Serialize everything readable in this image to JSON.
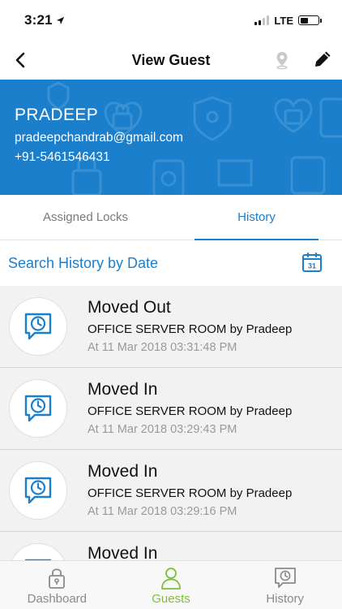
{
  "status_bar": {
    "time": "3:21",
    "network": "LTE",
    "signal_bars_on": 2,
    "battery_level": 0.45
  },
  "nav": {
    "title": "View Guest",
    "back_icon": "chevron-left-icon",
    "location_icon": "location-pin-icon",
    "edit_icon": "pencil-icon"
  },
  "guest": {
    "name": "PRADEEP",
    "email": "pradeepchandrab@gmail.com",
    "phone": "+91-5461546431"
  },
  "tabs": [
    {
      "label": "Assigned Locks",
      "active": false
    },
    {
      "label": "History",
      "active": true
    }
  ],
  "search": {
    "label": "Search History by Date",
    "calendar_day": "31"
  },
  "history": [
    {
      "title": "Moved Out",
      "lock": "OFFICE SERVER ROOM by Pradeep",
      "time": "At 11 Mar 2018 03:31:48 PM"
    },
    {
      "title": "Moved In",
      "lock": "OFFICE SERVER ROOM by Pradeep",
      "time": "At 11 Mar 2018 03:29:43 PM"
    },
    {
      "title": "Moved In",
      "lock": "OFFICE SERVER ROOM by Pradeep",
      "time": "At 11 Mar 2018 03:29:16 PM"
    },
    {
      "title": "Moved In",
      "lock": "",
      "time": ""
    }
  ],
  "bottom_tabs": [
    {
      "label": "Dashboard",
      "icon": "lock-icon",
      "active": false
    },
    {
      "label": "Guests",
      "icon": "person-icon",
      "active": true
    },
    {
      "label": "History",
      "icon": "clock-chat-icon",
      "active": false
    }
  ],
  "colors": {
    "primary_blue": "#1b7fcc",
    "active_green": "#7cbf3a",
    "list_background": "#f2f2f2"
  }
}
